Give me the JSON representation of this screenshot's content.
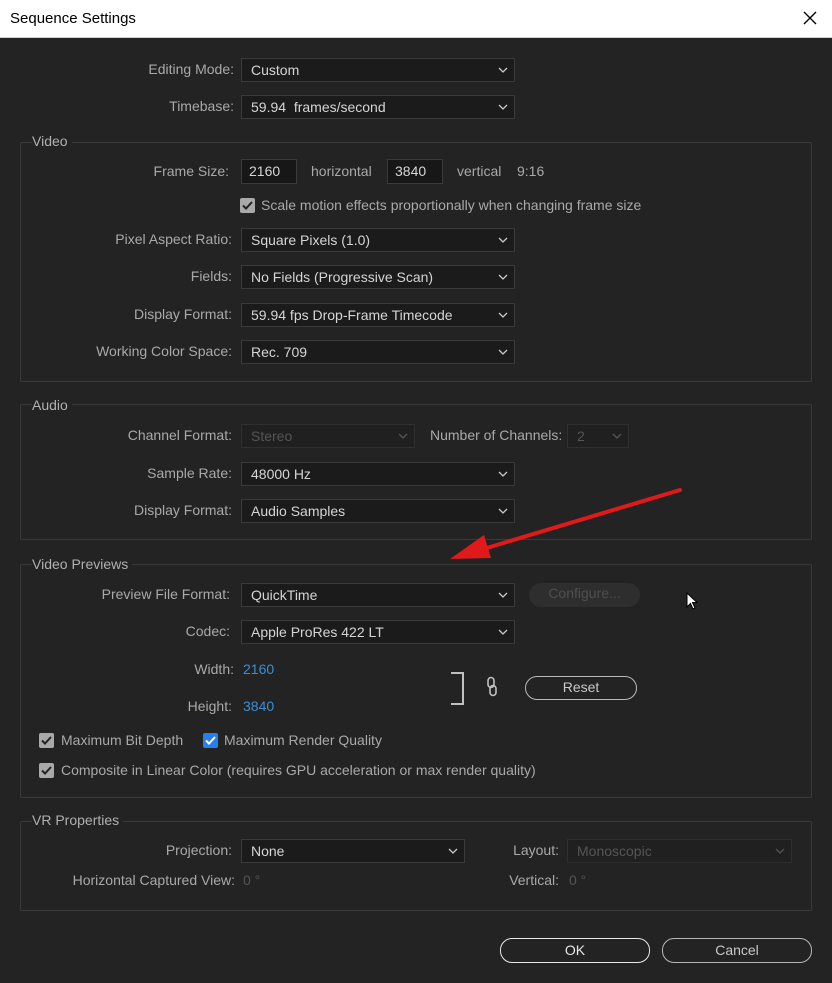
{
  "window": {
    "title": "Sequence Settings",
    "close_label": "close"
  },
  "general": {
    "editing_mode_label": "Editing Mode:",
    "editing_mode_value": "Custom",
    "timebase_label": "Timebase:",
    "timebase_value": "59.94  frames/second"
  },
  "video": {
    "group_title": "Video",
    "frame_size_label": "Frame Size:",
    "frame_width": "2160",
    "horizontal_label": "horizontal",
    "frame_height": "3840",
    "vertical_label": "vertical",
    "aspect_ratio": "9:16",
    "scale_motion_label": "Scale motion effects proportionally when changing frame size",
    "scale_motion_checked": true,
    "pixel_aspect_label": "Pixel Aspect Ratio:",
    "pixel_aspect_value": "Square Pixels (1.0)",
    "fields_label": "Fields:",
    "fields_value": "No Fields (Progressive Scan)",
    "display_format_label": "Display Format:",
    "display_format_value": "59.94 fps Drop-Frame Timecode",
    "color_space_label": "Working Color Space:",
    "color_space_value": "Rec. 709"
  },
  "audio": {
    "group_title": "Audio",
    "channel_format_label": "Channel Format:",
    "channel_format_value": "Stereo",
    "num_channels_label": "Number of Channels:",
    "num_channels_value": "2",
    "sample_rate_label": "Sample Rate:",
    "sample_rate_value": "48000 Hz",
    "display_format_label": "Display Format:",
    "display_format_value": "Audio Samples"
  },
  "previews": {
    "group_title": "Video Previews",
    "file_format_label": "Preview File Format:",
    "file_format_value": "QuickTime",
    "configure_label": "Configure...",
    "codec_label": "Codec:",
    "codec_value": "Apple ProRes 422 LT",
    "width_label": "Width:",
    "width_value": "2160",
    "height_label": "Height:",
    "height_value": "3840",
    "reset_label": "Reset",
    "max_bit_depth_label": "Maximum Bit Depth",
    "max_bit_depth_checked": true,
    "max_render_quality_label": "Maximum Render Quality",
    "max_render_quality_checked": true,
    "composite_linear_label": "Composite in Linear Color (requires GPU acceleration or max render quality)",
    "composite_linear_checked": true
  },
  "vr": {
    "group_title": "VR Properties",
    "projection_label": "Projection:",
    "projection_value": "None",
    "layout_label": "Layout:",
    "layout_value": "Monoscopic",
    "h_captured_label": "Horizontal Captured View:",
    "h_captured_value": "0 °",
    "vertical_label": "Vertical:",
    "vertical_value": "0 °"
  },
  "footer": {
    "ok_label": "OK",
    "cancel_label": "Cancel"
  },
  "colors": {
    "background": "#232323",
    "accent_blue": "#2680eb",
    "arrow_red": "#e0191b",
    "value_blue": "#3b8ed6"
  },
  "icons": [
    "close-icon",
    "chevron-down-icon",
    "checkmark-icon",
    "chain-link-icon",
    "mouse-cursor-icon",
    "annotation-arrow"
  ]
}
